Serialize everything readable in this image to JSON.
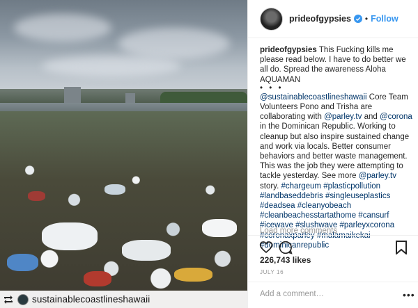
{
  "post": {
    "username": "prideofgypsies",
    "follow_label": "Follow",
    "separator": "•"
  },
  "caption": {
    "username": "prideofgypsies",
    "text": "This Fucking kills me please read below. I have to do better we all do. Spread the awareness Aloha AQUAMAN",
    "dots": "• • •",
    "mention_1": "@sustainablecoastlineshawaii",
    "text_2": "Core Team Volunteers Pono and Trisha are collaborating with",
    "mention_2": "@parley.tv",
    "and": "and",
    "mention_3": "@corona",
    "text_3": "in the Dominican Republic. Working to cleanup but also inspire sustained change and work via locals. Better consumer behaviors and better waste management. This was the job they were attempting to tackle yesterday. See more",
    "mention_4": "@parley.tv",
    "text_4": "story.",
    "hashtags": [
      "#chargeum",
      "#plasticpollution",
      "#landbaseddebris",
      "#singleuseplastics",
      "#deadsea",
      "#cleanyobeach",
      "#cleanbeachesstartathome",
      "#cansurf",
      "#icewave",
      "#slushwave",
      "#parleyxcorona",
      "#coronaxparley",
      "#malamaikekai",
      "#dominicanrepublic"
    ]
  },
  "load_more": "Load more comments",
  "likes": "226,743 likes",
  "date": "JULY 16",
  "comment_placeholder": "Add a comment…",
  "more_options": "•••",
  "repost": {
    "handle": "sustainablecoastlineshawaii"
  },
  "icons": {
    "verified": "verified-badge-icon",
    "heart": "heart-icon",
    "comment": "comment-icon",
    "save": "bookmark-icon",
    "repost": "repost-icon"
  },
  "colors": {
    "link_blue": "#3897f0",
    "hashtag": "#003569",
    "text": "#262626",
    "muted": "#999999"
  }
}
